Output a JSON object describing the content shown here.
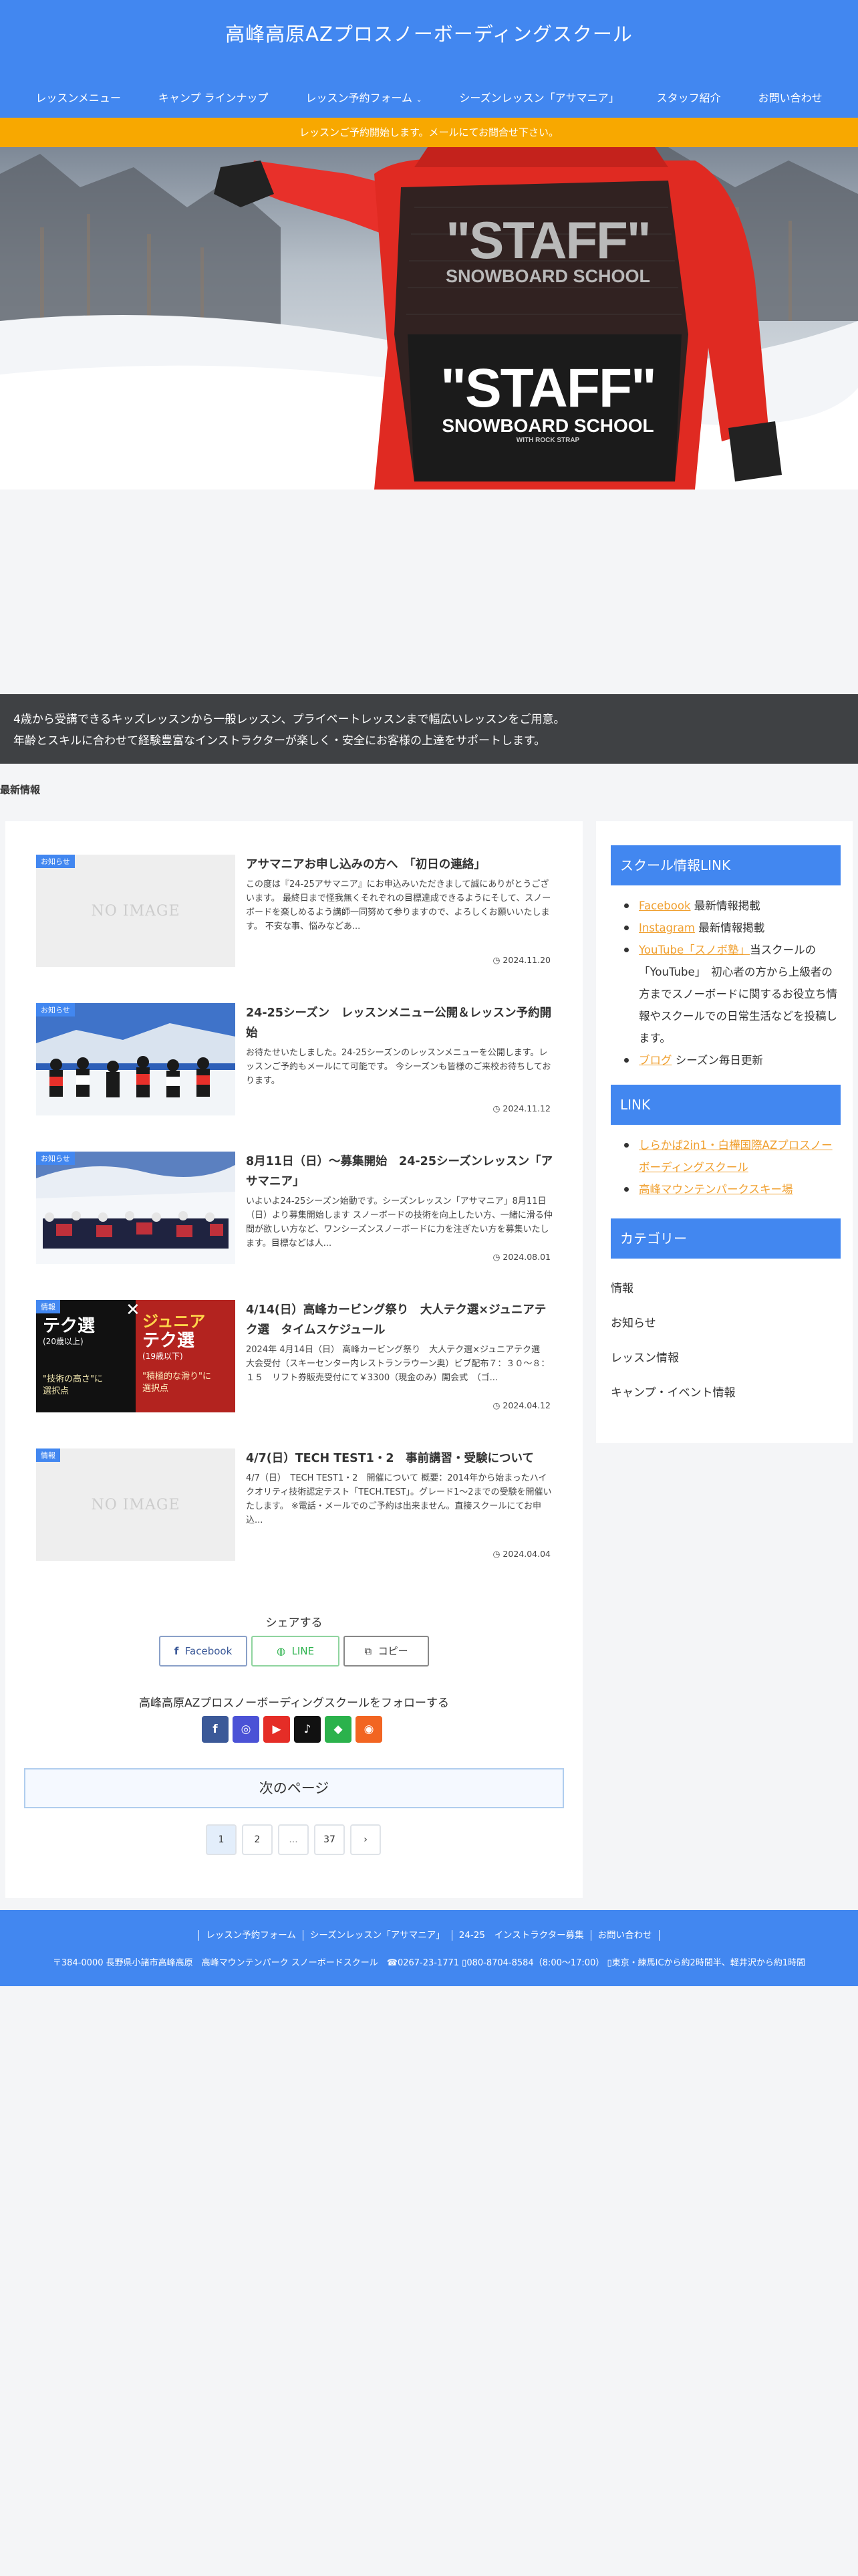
{
  "site": {
    "title": "高峰高原AZプロスノーボーディングスクール"
  },
  "nav": [
    {
      "label": "レッスンメニュー",
      "caret": false
    },
    {
      "label": "キャンプ ラインナップ",
      "caret": false
    },
    {
      "label": "レッスン予約フォーム",
      "caret": true
    },
    {
      "label": "シーズンレッスン「アサマニア」",
      "caret": false
    },
    {
      "label": "スタッフ紹介",
      "caret": false
    },
    {
      "label": "お問い合わせ",
      "caret": false
    }
  ],
  "notice": "レッスンご予約開始します。メールにてお問合せ下さい。",
  "hero": {
    "bib_text_1": "\"STAFF\"",
    "bib_text_2": "SNOWBOARD SCHOOL",
    "bib_text_3": "\"STAFF\"",
    "bib_text_4": "SNOWBOARD SCHOOL",
    "bib_small": "WITH ROCK STRAP"
  },
  "intro": {
    "line1": "4歳から受講できるキッズレッスンから一般レッスン、プライベートレッスンまで幅広いレッスンをご用意。",
    "line2": "年齢とスキルに合わせて経験豊富なインストラクターが楽しく・安全にお客様の上達をサポートします。"
  },
  "latest_label": "最新情報",
  "posts": [
    {
      "category": "お知らせ",
      "thumb": "noimage",
      "noimage_text": "NO IMAGE",
      "title": "アサマニアお申し込みの方へ　「初日の連絡」",
      "snippet": "この度は『24-25アサマニア』にお申込みいただきまして誠にありがとうございます。 最終日まで怪我無くそれぞれの目標達成できるようにそして、スノーボードを楽しめるよう講師一同努めて参りますので、よろしくお願いいたします。 不安な事、悩みなどあ...",
      "date": "2024.11.20"
    },
    {
      "category": "お知らせ",
      "thumb": "group",
      "title": "24-25シーズン　レッスンメニュー公開＆レッスン予約開始",
      "snippet": "お待たせいたしました。24-25シーズンのレッスンメニューを公開します。レッスンご予約もメールにて可能です。 今シーズンも皆様のご来校お待ちしております。",
      "date": "2024.11.12"
    },
    {
      "category": "お知らせ",
      "thumb": "slope",
      "title": "8月11日（日）～募集開始　24-25シーズンレッスン「アサマニア」",
      "snippet": "いよいよ24-25シーズン始動です。シーズンレッスン「アサマニア」8月11日（日）より募集開始します スノーボードの技術を向上したい方、一緒に滑る仲間が欲しい方など、ワンシーズンスノーボードに力を注ぎたい方を募集いたします。目標などは人...",
      "date": "2024.08.01"
    },
    {
      "category": "情報",
      "thumb": "poster",
      "poster": {
        "left_title": "テク選",
        "left_sub": "(20歳以上)",
        "left_note": "\"技術の高さ\"に\n選択点",
        "right_title": "ジュニア",
        "right_title2": "テク選",
        "right_sub": "(19歳以下)",
        "right_note": "\"積極的な滑り\"に\n選択点"
      },
      "title": "4/14(日）高峰カービング祭り　大人テク選×ジュニアテク選　タイムスケジュール",
      "snippet": "2024年 4月14日（日） 高峰カービング祭り　大人テク選×ジュニアテク選　　　　　大会受付（スキーセンター内レストランラウーン奥）ビブ配布７：３０～８：１５　リフト券販売受付にて￥3300（現金のみ）開会式　（ゴ...",
      "date": "2024.04.12"
    },
    {
      "category": "情報",
      "thumb": "noimage",
      "noimage_text": "NO IMAGE",
      "title": "4/7(日）TECH TEST1・2　事前講習・受験について",
      "snippet": "4/7（日）　TECH TEST1・2　開催について 概要：2014年から始まったハイクオリティ技術認定テスト「TECH.TEST」。グレード1～2までの受験を開催いたします。 ※電話・メールでのご予約は出来ません。直接スクールにてお申込...",
      "date": "2024.04.04"
    }
  ],
  "share": {
    "title": "シェアする",
    "facebook": "Facebook",
    "line": "LINE",
    "copy": "コピー"
  },
  "follow": {
    "title": "高峰高原AZプロスノーボーディングスクールをフォローする",
    "icons": [
      {
        "name": "facebook",
        "color": "#3b5998",
        "glyph": "f"
      },
      {
        "name": "instagram",
        "color": "#4b52d6",
        "glyph": "◎"
      },
      {
        "name": "youtube",
        "color": "#e52d27",
        "glyph": "▶"
      },
      {
        "name": "tiktok",
        "color": "#111111",
        "glyph": "♪"
      },
      {
        "name": "feedly",
        "color": "#2bb24c",
        "glyph": "◆"
      },
      {
        "name": "rss",
        "color": "#f26522",
        "glyph": "◉"
      }
    ]
  },
  "next_page": "次のページ",
  "pagination": [
    "1",
    "2",
    "...",
    "37",
    "›"
  ],
  "sidebar": {
    "school_link_title": "スクール情報LINK",
    "school_links": [
      {
        "link": "Facebook",
        "rest": " 最新情報掲載"
      },
      {
        "link": "Instagram",
        "rest": " 最新情報掲載"
      },
      {
        "link": "YouTube「スノボ塾」",
        "rest": "当スクールの「YouTube」　初心者の方から上級者の方までスノーボードに関するお役立ち情報やスクールでの日常生活などを投稿します。"
      },
      {
        "link": "ブログ",
        "rest": " シーズン毎日更新"
      }
    ],
    "link_title": "LINK",
    "links": [
      "しらかば2in1・白樺国際AZプロスノーボーディングスクール",
      "高峰マウンテンパークスキー場"
    ],
    "category_title": "カテゴリー",
    "categories": [
      "情報",
      "お知らせ",
      "レッスン情報",
      "キャンプ・イベント情報"
    ]
  },
  "footer": {
    "nav": [
      "レッスン予約フォーム",
      "シーズンレッスン「アサマニア」",
      "24-25　インストラクター募集",
      "お問い合わせ"
    ],
    "info": "〒384-0000 長野県小諸市高峰高原　高峰マウンテンパーク スノーボードスクール　☎0267-23-1771 ▯080-8704-8584（8:00〜17:00） ▯東京・練馬ICから約2時間半、軽井沢から約1時間"
  },
  "colors": {
    "brand": "#4287f0",
    "notice": "#f8a800",
    "link": "#f0a030"
  }
}
